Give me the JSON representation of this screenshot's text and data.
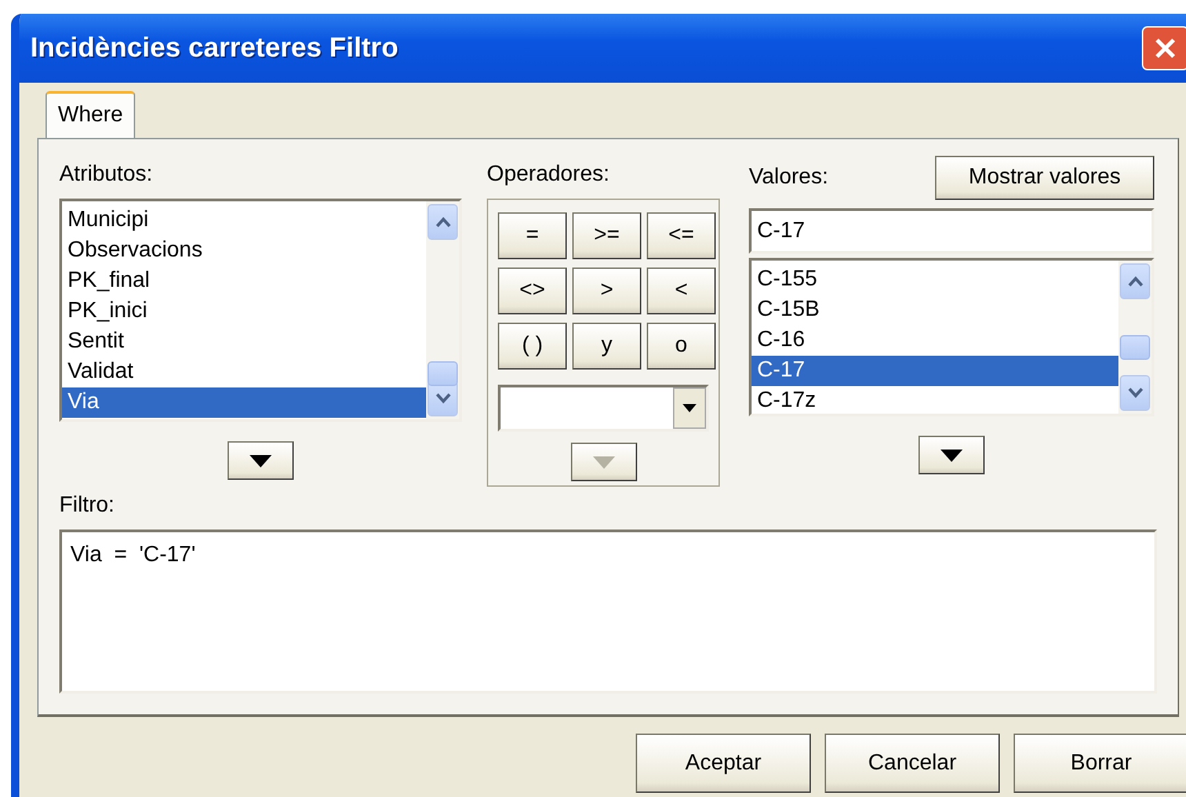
{
  "window": {
    "title": "Incidències carreteres Filtro"
  },
  "tabs": [
    {
      "label": "Where",
      "selected": true
    }
  ],
  "attributes": {
    "label": "Atributos:",
    "items": [
      {
        "text": "Municipi",
        "selected": false
      },
      {
        "text": "Observacions",
        "selected": false
      },
      {
        "text": "PK_final",
        "selected": false
      },
      {
        "text": "PK_inici",
        "selected": false
      },
      {
        "text": "Sentit",
        "selected": false
      },
      {
        "text": "Validat",
        "selected": false
      },
      {
        "text": "Via",
        "selected": true
      }
    ],
    "move_button": {
      "disabled": false
    }
  },
  "operators": {
    "label": "Operadores:",
    "buttons": [
      "=",
      ">=",
      "<=",
      "<>",
      ">",
      "<",
      "( )",
      "y",
      "o"
    ],
    "move_button": {
      "disabled": true
    }
  },
  "values": {
    "label": "Valores:",
    "show_button": "Mostrar valores",
    "input": "C-17",
    "items": [
      {
        "text": "C-155",
        "selected": false
      },
      {
        "text": "C-15B",
        "selected": false
      },
      {
        "text": "C-16",
        "selected": false
      },
      {
        "text": "C-17",
        "selected": true
      },
      {
        "text": "C-17z",
        "selected": false
      }
    ],
    "move_button": {
      "disabled": false
    }
  },
  "filter": {
    "label": "Filtro:",
    "value": "Via  =  'C-17'"
  },
  "buttons": [
    "Aceptar",
    "Cancelar",
    "Borrar"
  ]
}
